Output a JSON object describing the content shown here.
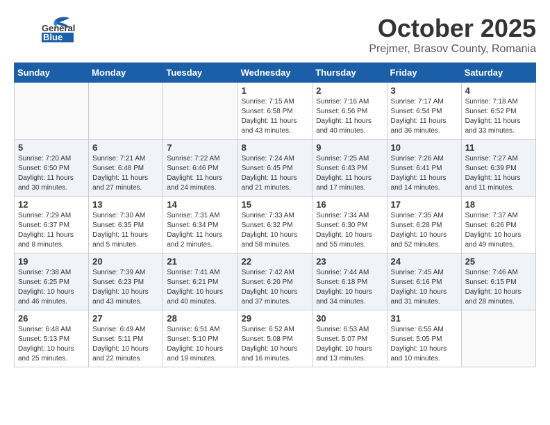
{
  "header": {
    "logo_general": "General",
    "logo_blue": "Blue",
    "month": "October 2025",
    "location": "Prejmer, Brasov County, Romania"
  },
  "weekdays": [
    "Sunday",
    "Monday",
    "Tuesday",
    "Wednesday",
    "Thursday",
    "Friday",
    "Saturday"
  ],
  "weeks": [
    [
      {
        "day": "",
        "detail": ""
      },
      {
        "day": "",
        "detail": ""
      },
      {
        "day": "",
        "detail": ""
      },
      {
        "day": "1",
        "detail": "Sunrise: 7:15 AM\nSunset: 6:58 PM\nDaylight: 11 hours and 43 minutes."
      },
      {
        "day": "2",
        "detail": "Sunrise: 7:16 AM\nSunset: 6:56 PM\nDaylight: 11 hours and 40 minutes."
      },
      {
        "day": "3",
        "detail": "Sunrise: 7:17 AM\nSunset: 6:54 PM\nDaylight: 11 hours and 36 minutes."
      },
      {
        "day": "4",
        "detail": "Sunrise: 7:18 AM\nSunset: 6:52 PM\nDaylight: 11 hours and 33 minutes."
      }
    ],
    [
      {
        "day": "5",
        "detail": "Sunrise: 7:20 AM\nSunset: 6:50 PM\nDaylight: 11 hours and 30 minutes."
      },
      {
        "day": "6",
        "detail": "Sunrise: 7:21 AM\nSunset: 6:48 PM\nDaylight: 11 hours and 27 minutes."
      },
      {
        "day": "7",
        "detail": "Sunrise: 7:22 AM\nSunset: 6:46 PM\nDaylight: 11 hours and 24 minutes."
      },
      {
        "day": "8",
        "detail": "Sunrise: 7:24 AM\nSunset: 6:45 PM\nDaylight: 11 hours and 21 minutes."
      },
      {
        "day": "9",
        "detail": "Sunrise: 7:25 AM\nSunset: 6:43 PM\nDaylight: 11 hours and 17 minutes."
      },
      {
        "day": "10",
        "detail": "Sunrise: 7:26 AM\nSunset: 6:41 PM\nDaylight: 11 hours and 14 minutes."
      },
      {
        "day": "11",
        "detail": "Sunrise: 7:27 AM\nSunset: 6:39 PM\nDaylight: 11 hours and 11 minutes."
      }
    ],
    [
      {
        "day": "12",
        "detail": "Sunrise: 7:29 AM\nSunset: 6:37 PM\nDaylight: 11 hours and 8 minutes."
      },
      {
        "day": "13",
        "detail": "Sunrise: 7:30 AM\nSunset: 6:35 PM\nDaylight: 11 hours and 5 minutes."
      },
      {
        "day": "14",
        "detail": "Sunrise: 7:31 AM\nSunset: 6:34 PM\nDaylight: 11 hours and 2 minutes."
      },
      {
        "day": "15",
        "detail": "Sunrise: 7:33 AM\nSunset: 6:32 PM\nDaylight: 10 hours and 58 minutes."
      },
      {
        "day": "16",
        "detail": "Sunrise: 7:34 AM\nSunset: 6:30 PM\nDaylight: 10 hours and 55 minutes."
      },
      {
        "day": "17",
        "detail": "Sunrise: 7:35 AM\nSunset: 6:28 PM\nDaylight: 10 hours and 52 minutes."
      },
      {
        "day": "18",
        "detail": "Sunrise: 7:37 AM\nSunset: 6:26 PM\nDaylight: 10 hours and 49 minutes."
      }
    ],
    [
      {
        "day": "19",
        "detail": "Sunrise: 7:38 AM\nSunset: 6:25 PM\nDaylight: 10 hours and 46 minutes."
      },
      {
        "day": "20",
        "detail": "Sunrise: 7:39 AM\nSunset: 6:23 PM\nDaylight: 10 hours and 43 minutes."
      },
      {
        "day": "21",
        "detail": "Sunrise: 7:41 AM\nSunset: 6:21 PM\nDaylight: 10 hours and 40 minutes."
      },
      {
        "day": "22",
        "detail": "Sunrise: 7:42 AM\nSunset: 6:20 PM\nDaylight: 10 hours and 37 minutes."
      },
      {
        "day": "23",
        "detail": "Sunrise: 7:44 AM\nSunset: 6:18 PM\nDaylight: 10 hours and 34 minutes."
      },
      {
        "day": "24",
        "detail": "Sunrise: 7:45 AM\nSunset: 6:16 PM\nDaylight: 10 hours and 31 minutes."
      },
      {
        "day": "25",
        "detail": "Sunrise: 7:46 AM\nSunset: 6:15 PM\nDaylight: 10 hours and 28 minutes."
      }
    ],
    [
      {
        "day": "26",
        "detail": "Sunrise: 6:48 AM\nSunset: 5:13 PM\nDaylight: 10 hours and 25 minutes."
      },
      {
        "day": "27",
        "detail": "Sunrise: 6:49 AM\nSunset: 5:11 PM\nDaylight: 10 hours and 22 minutes."
      },
      {
        "day": "28",
        "detail": "Sunrise: 6:51 AM\nSunset: 5:10 PM\nDaylight: 10 hours and 19 minutes."
      },
      {
        "day": "29",
        "detail": "Sunrise: 6:52 AM\nSunset: 5:08 PM\nDaylight: 10 hours and 16 minutes."
      },
      {
        "day": "30",
        "detail": "Sunrise: 6:53 AM\nSunset: 5:07 PM\nDaylight: 10 hours and 13 minutes."
      },
      {
        "day": "31",
        "detail": "Sunrise: 6:55 AM\nSunset: 5:05 PM\nDaylight: 10 hours and 10 minutes."
      },
      {
        "day": "",
        "detail": ""
      }
    ]
  ]
}
